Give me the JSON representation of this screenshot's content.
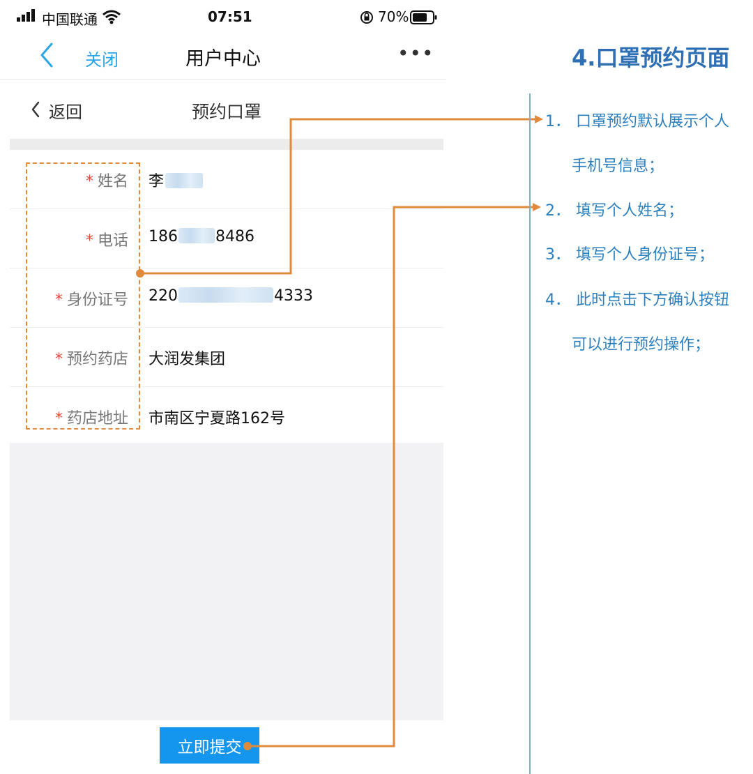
{
  "status_bar": {
    "carrier": "中国联通",
    "time": "07:51",
    "battery": "70%"
  },
  "nav": {
    "back_icon": "chevron-left-icon",
    "close_label": "关闭",
    "title": "用户中心",
    "more": "•••"
  },
  "sub_header": {
    "back_label": "返回",
    "title": "预约口罩"
  },
  "form": {
    "rows": [
      {
        "label": "姓名",
        "value": "李",
        "masked": true
      },
      {
        "label": "电话",
        "value_prefix": "186",
        "value_suffix": "8486",
        "masked": true
      },
      {
        "label": "身份证号",
        "value_prefix": "220",
        "value_suffix": "4333",
        "masked": true
      },
      {
        "label": "预约药店",
        "value": "大润发集团"
      },
      {
        "label": "药店地址",
        "value": "市南区宁夏路162号"
      }
    ],
    "required_mark": "*",
    "submit_label": "立即提交"
  },
  "annotation": {
    "heading": "4.口罩预约页面",
    "steps": [
      {
        "number": "1．",
        "line1": "口罩预约默认展示个人",
        "line2": "手机号信息；"
      },
      {
        "number": "2．",
        "line1": "填写个人姓名；"
      },
      {
        "number": "3．",
        "line1": "填写个人身份证号；"
      },
      {
        "number": "4．",
        "line1": "此时点击下方确认按钮",
        "line2": "可以进行预约操作；"
      }
    ]
  },
  "colors": {
    "accent_blue": "#2aa5e5",
    "button_blue": "#1596ee",
    "annotation_blue": "#2c7fbd",
    "heading_blue": "#2f6fb4",
    "connector_orange": "#e08a3c",
    "required_red": "#e24a3b"
  }
}
